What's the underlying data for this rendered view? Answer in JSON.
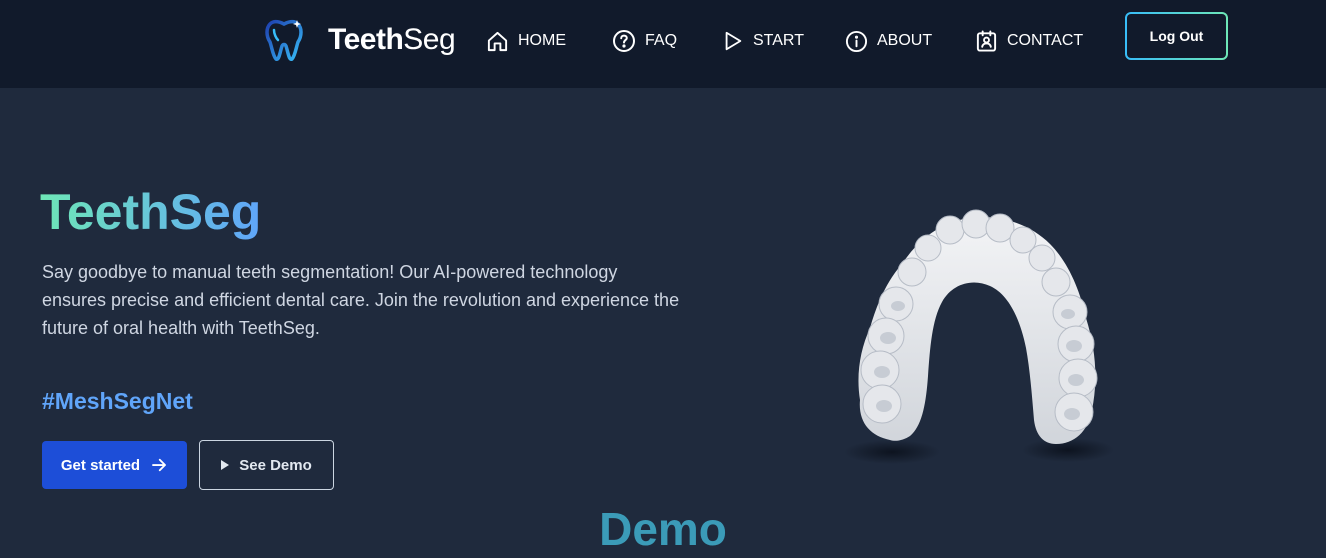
{
  "navbar": {
    "brand": {
      "bold": "Teeth",
      "light": "Seg"
    },
    "items": [
      {
        "label": "HOME",
        "icon": "home-icon"
      },
      {
        "label": "FAQ",
        "icon": "help-circle-icon"
      },
      {
        "label": "START",
        "icon": "play-icon"
      },
      {
        "label": "ABOUT",
        "icon": "info-icon"
      },
      {
        "label": "CONTACT",
        "icon": "contact-badge-icon"
      }
    ],
    "logout_label": "Log Out"
  },
  "hero": {
    "title": "TeethSeg",
    "description": "Say goodbye to manual teeth segmentation! Our AI-powered technology ensures precise and efficient dental care. Join the revolution and experience the future of oral health with TeethSeg.",
    "hashtag": "#MeshSegNet",
    "primary_button": "Get started",
    "secondary_button": "See Demo",
    "image_icon": "dental-arch-model"
  },
  "demo": {
    "heading": "Demo"
  },
  "colors": {
    "background": "#1f2a3d",
    "navbar": "#111a2b",
    "accent_blue": "#1d4ed8",
    "gradient_start": "#6ee7b7",
    "gradient_end": "#60a5fa",
    "demo_heading": "#3b9bb8"
  }
}
